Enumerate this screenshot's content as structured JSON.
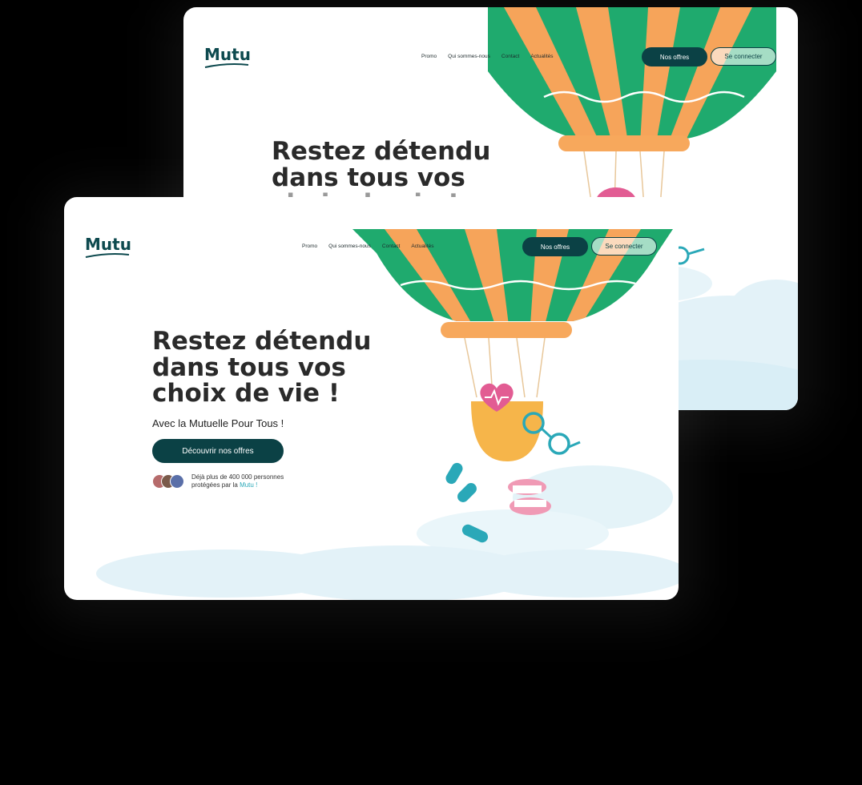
{
  "brand": {
    "logo": "Mutu"
  },
  "nav": {
    "links": [
      "Promo",
      "Qui sommes-nous",
      "Contact",
      "Actualités"
    ],
    "primary_button": "Nos offres",
    "secondary_button": "Se connecter"
  },
  "hero": {
    "line1": "Restez détendu",
    "line2": "dans tous vos",
    "line3": "choix de vie !",
    "subtitle": "Avec la Mutuelle Pour Tous !",
    "cta": "Découvrir nos offres",
    "proof_line1": "Déjà plus de 400 000 personnes",
    "proof_line2": "protégées par la",
    "proof_brand": "Mutu !"
  },
  "colors": {
    "brand_dark": "#0b4145",
    "accent": "#2aa8b8",
    "balloon_green": "#1faa6e",
    "balloon_orange": "#f6a45a",
    "cloud": "#dff1f7"
  },
  "icons": [
    "balloon-illustration",
    "heart-icon",
    "glasses-icon",
    "pill-icon",
    "dentures-icon",
    "cloud-illustration"
  ]
}
